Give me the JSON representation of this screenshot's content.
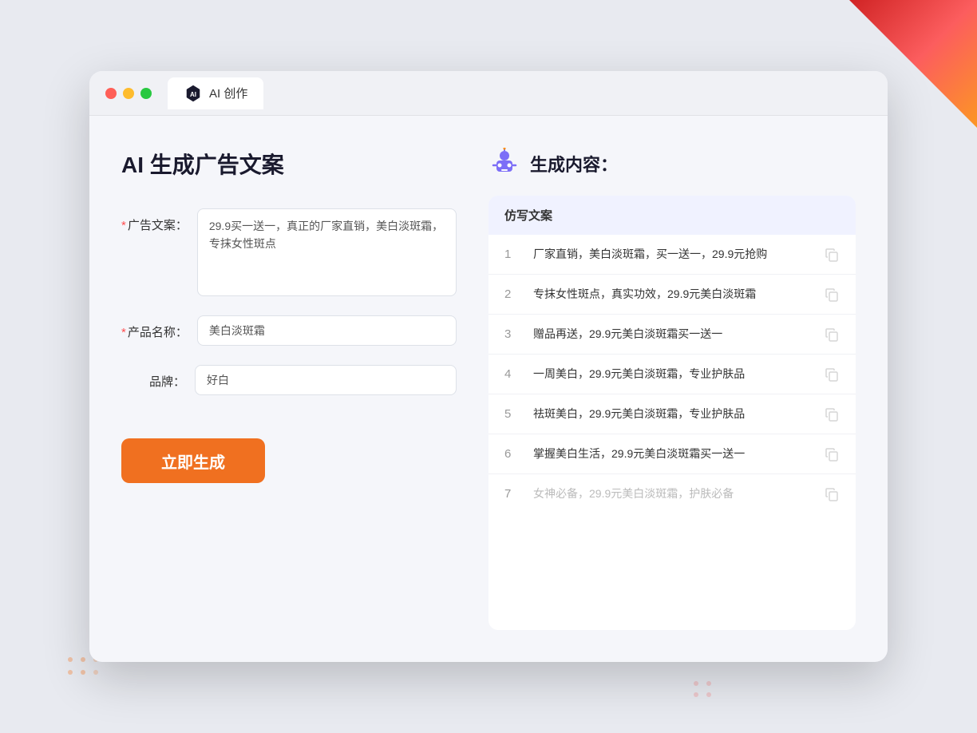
{
  "browser": {
    "tab_label": "AI 创作"
  },
  "page": {
    "title": "AI 生成广告文案"
  },
  "form": {
    "ad_copy_label": "广告文案：",
    "ad_copy_required": "*",
    "ad_copy_value": "29.9买一送一，真正的厂家直销，美白淡斑霜，专抹女性斑点",
    "product_name_label": "产品名称：",
    "product_name_required": "*",
    "product_name_value": "美白淡斑霜",
    "brand_label": "品牌：",
    "brand_value": "好白",
    "generate_btn": "立即生成"
  },
  "result": {
    "header_title": "生成内容：",
    "table_header": "仿写文案",
    "items": [
      {
        "num": "1",
        "text": "厂家直销，美白淡斑霜，买一送一，29.9元抢购",
        "faded": false
      },
      {
        "num": "2",
        "text": "专抹女性斑点，真实功效，29.9元美白淡斑霜",
        "faded": false
      },
      {
        "num": "3",
        "text": "赠品再送，29.9元美白淡斑霜买一送一",
        "faded": false
      },
      {
        "num": "4",
        "text": "一周美白，29.9元美白淡斑霜，专业护肤品",
        "faded": false
      },
      {
        "num": "5",
        "text": "祛斑美白，29.9元美白淡斑霜，专业护肤品",
        "faded": false
      },
      {
        "num": "6",
        "text": "掌握美白生活，29.9元美白淡斑霜买一送一",
        "faded": false
      },
      {
        "num": "7",
        "text": "女神必备，29.9元美白淡斑霜，护肤必备",
        "faded": true
      }
    ]
  }
}
